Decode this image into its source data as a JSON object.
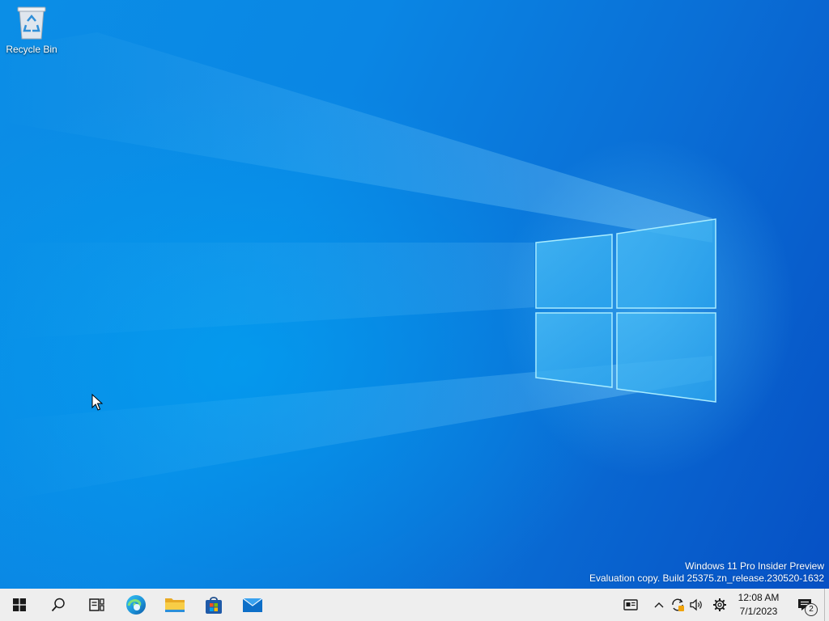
{
  "desktop": {
    "icons": [
      {
        "label": "Recycle Bin",
        "icon": "recycle-bin-icon"
      }
    ],
    "watermark": {
      "line1": "Windows 11 Pro Insider Preview",
      "line2": "Evaluation copy. Build 25375.zn_release.230520-1632"
    }
  },
  "taskbar": {
    "pinned": [
      {
        "name": "Start",
        "icon": "windows-start-icon"
      },
      {
        "name": "Search",
        "icon": "search-icon"
      },
      {
        "name": "Task View",
        "icon": "task-view-icon"
      },
      {
        "name": "Microsoft Edge",
        "icon": "edge-icon"
      },
      {
        "name": "File Explorer",
        "icon": "folder-icon"
      },
      {
        "name": "Microsoft Store",
        "icon": "store-icon"
      },
      {
        "name": "Mail",
        "icon": "mail-icon"
      }
    ],
    "tray": {
      "icons": [
        "news-widget-icon",
        "chevron-up-icon",
        "sync-icon",
        "volume-icon",
        "settings-gear-icon"
      ],
      "time": "12:08 AM",
      "date": "7/1/2023",
      "notification_count": "2"
    }
  },
  "colors": {
    "accent": "#0078d4",
    "taskbar_bg": "#eeeeee"
  }
}
